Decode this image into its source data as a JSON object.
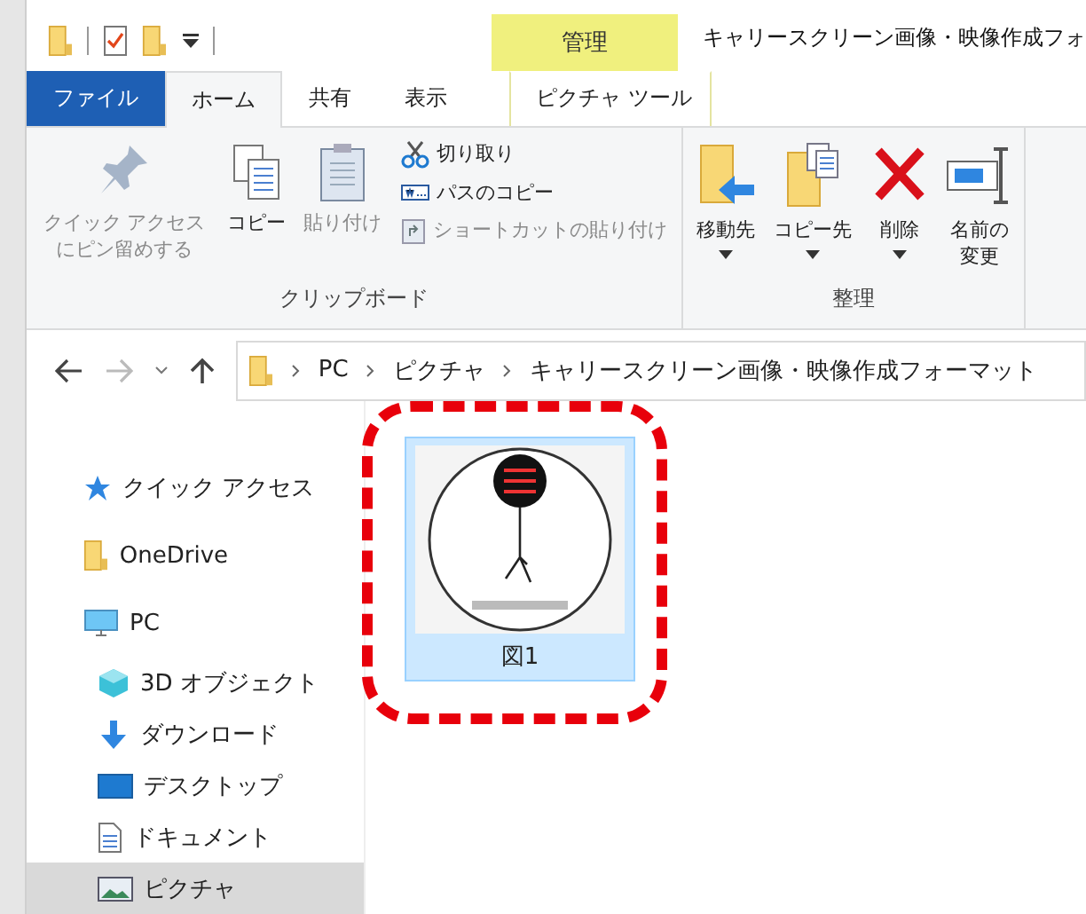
{
  "window": {
    "title": "キャリースクリーン画像・映像作成フォ"
  },
  "tabs": [
    {
      "label": "ファイル",
      "kind": "file",
      "selected": false
    },
    {
      "label": "ホーム",
      "kind": "tab",
      "selected": true
    },
    {
      "label": "共有",
      "kind": "tab",
      "selected": false
    },
    {
      "label": "表示",
      "kind": "tab",
      "selected": false
    }
  ],
  "contextual_tab": {
    "group": "管理",
    "label": "ピクチャ ツール",
    "selected": false
  },
  "ribbon": {
    "groups": [
      {
        "label": "クリップボード",
        "buttons": [
          {
            "kind": "large",
            "label": "クイック アクセスにピン留めする",
            "disabled": true
          },
          {
            "kind": "large",
            "label": "コピー",
            "disabled": false
          },
          {
            "kind": "large",
            "label": "貼り付け",
            "disabled": true
          },
          {
            "kind": "small",
            "label": "切り取り",
            "disabled": false
          },
          {
            "kind": "small",
            "label": "パスのコピー",
            "disabled": false
          },
          {
            "kind": "small",
            "label": "ショートカットの貼り付け",
            "disabled": true
          }
        ]
      },
      {
        "label": "整理",
        "buttons": [
          {
            "kind": "large",
            "label": "移動先",
            "dropdown": true,
            "disabled": false
          },
          {
            "kind": "large",
            "label": "コピー先",
            "dropdown": true,
            "disabled": false
          },
          {
            "kind": "large",
            "label": "削除",
            "dropdown": true,
            "disabled": false
          },
          {
            "kind": "large",
            "label": "名前の変更",
            "dropdown": false,
            "disabled": false
          }
        ]
      }
    ]
  },
  "address": {
    "segments": [
      "PC",
      "ピクチャ",
      "キャリースクリーン画像・映像作成フォーマット"
    ]
  },
  "nav": [
    {
      "label": "クイック アクセス",
      "selected": false
    },
    {
      "label": "OneDrive",
      "selected": false
    },
    {
      "label": "PC",
      "selected": false,
      "children": [
        {
          "label": "3D オブジェクト",
          "selected": false
        },
        {
          "label": "ダウンロード",
          "selected": false
        },
        {
          "label": "デスクトップ",
          "selected": false
        },
        {
          "label": "ドキュメント",
          "selected": false
        },
        {
          "label": "ピクチャ",
          "selected": true
        }
      ]
    }
  ],
  "files": [
    {
      "name": "図1",
      "selected": true
    }
  ]
}
